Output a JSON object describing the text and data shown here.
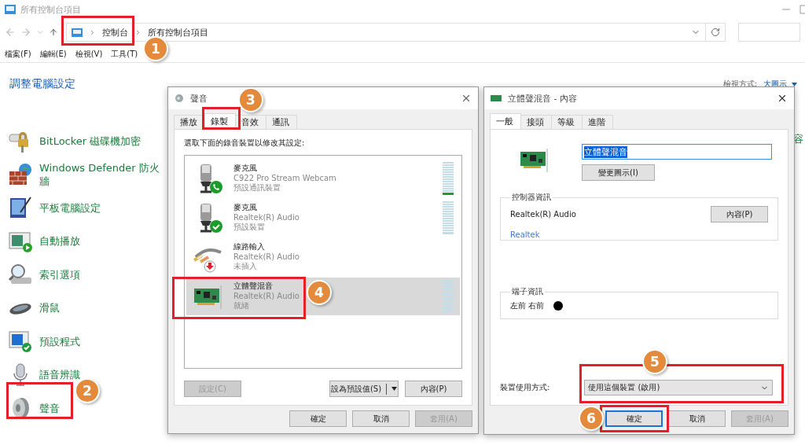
{
  "explorer": {
    "title": "所有控制台項目",
    "breadcrumb": [
      "控制台",
      "所有控制台項目"
    ],
    "menu": [
      "檔案(F)",
      "編輯(E)",
      "檢視(V)",
      "工具(T)"
    ],
    "heading": "調整電腦設定",
    "view_label": "檢視方式:",
    "view_value": "大圖示",
    "items": [
      {
        "label": "BitLocker 磁碟機加密",
        "kind": "lock"
      },
      {
        "label": "Windows Defender 防火牆",
        "kind": "firewall"
      },
      {
        "label": "平板電腦設定",
        "kind": "tablet"
      },
      {
        "label": "自動播放",
        "kind": "autoplay"
      },
      {
        "label": "索引選項",
        "kind": "indexing"
      },
      {
        "label": "滑鼠",
        "kind": "mouse"
      },
      {
        "label": "預設程式",
        "kind": "defaults"
      },
      {
        "label": "語音辨識",
        "kind": "speech"
      },
      {
        "label": "聲音",
        "kind": "sound"
      }
    ],
    "right_item": "容"
  },
  "sound_dialog": {
    "title": "聲音",
    "tabs": [
      {
        "label": "播放",
        "selected": false
      },
      {
        "label": "錄製",
        "selected": true
      },
      {
        "label": "音效",
        "selected": false
      },
      {
        "label": "通訊",
        "selected": false
      }
    ],
    "prompt": "選取下面的錄音裝置以修改其設定:",
    "devices": [
      {
        "name": "麥克風",
        "detail": "C922 Pro Stream Webcam",
        "status": "預設通訊裝置",
        "kind": "webcam",
        "level": 0.07,
        "selected": false
      },
      {
        "name": "麥克風",
        "detail": "Realtek(R) Audio",
        "status": "預設裝置",
        "kind": "microphone",
        "level": 0,
        "selected": false
      },
      {
        "name": "線路輸入",
        "detail": "Realtek(R) Audio",
        "status": "未插入",
        "kind": "linein",
        "selected": false
      },
      {
        "name": "立體聲混音",
        "detail": "Realtek(R) Audio",
        "status": "就緒",
        "kind": "soundcard",
        "level": 0,
        "selected": true
      }
    ],
    "actions": [
      {
        "label": "設定(C)",
        "disabled": true,
        "kind": "plain"
      },
      {
        "label": "設為預設值(S)",
        "disabled": false,
        "kind": "split"
      },
      {
        "label": "內容(P)",
        "disabled": false,
        "kind": "plain"
      }
    ],
    "footer": [
      {
        "label": "確定",
        "disabled": false,
        "focused": false
      },
      {
        "label": "取消",
        "disabled": false,
        "focused": false
      },
      {
        "label": "套用(A)",
        "disabled": true,
        "focused": false
      }
    ]
  },
  "properties_dialog": {
    "title": "立體聲混音 - 內容",
    "tabs": [
      {
        "label": "一般",
        "selected": true
      },
      {
        "label": "接頭",
        "selected": false
      },
      {
        "label": "等級",
        "selected": false
      },
      {
        "label": "進階",
        "selected": false
      }
    ],
    "name_value": "立體聲混音",
    "change_icon": "變更圖示(I)",
    "controller": {
      "title": "控制器資訊",
      "name": "Realtek(R) Audio",
      "button": "內容(P)",
      "link": "Realtek"
    },
    "jack": {
      "title": "端子資訊",
      "channels": "左前 右前",
      "color": "#000000"
    },
    "usage_label": "裝置使用方式:",
    "usage_value": "使用這個裝置 (啟用)",
    "footer": [
      {
        "label": "確定",
        "disabled": false,
        "focused": true
      },
      {
        "label": "取消",
        "disabled": false,
        "focused": false
      },
      {
        "label": "套用(A)",
        "disabled": true,
        "focused": false
      }
    ]
  },
  "annotations": [
    {
      "number": "1"
    },
    {
      "number": "2"
    },
    {
      "number": "3"
    },
    {
      "number": "4"
    },
    {
      "number": "5"
    },
    {
      "number": "6"
    }
  ]
}
